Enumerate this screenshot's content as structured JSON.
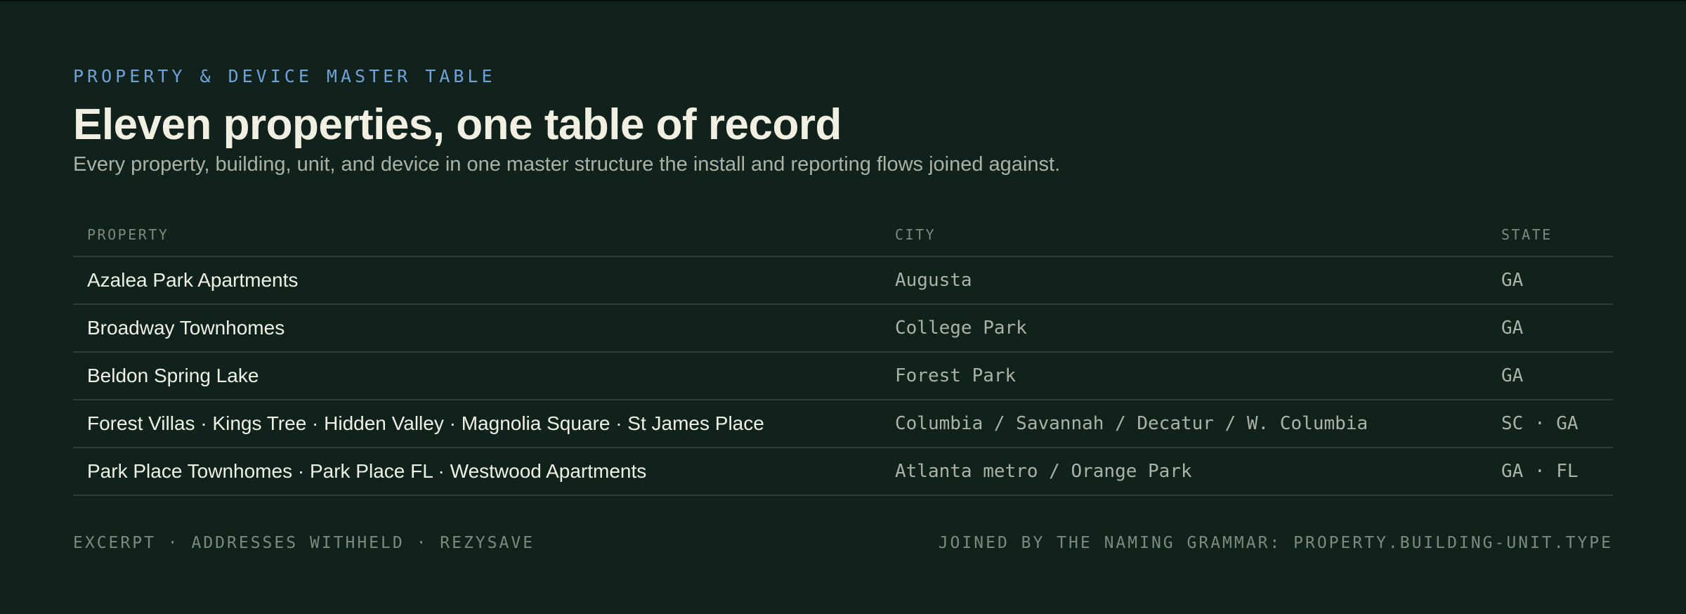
{
  "header": {
    "eyebrow": "PROPERTY & DEVICE MASTER TABLE",
    "title": "Eleven properties, one table of record",
    "subtitle": "Every property, building, unit, and device in one master structure the install and reporting flows joined against."
  },
  "table": {
    "columns": [
      "PROPERTY",
      "CITY",
      "STATE"
    ],
    "rows": [
      {
        "property": "Azalea Park Apartments",
        "city": "Augusta",
        "state": "GA"
      },
      {
        "property": "Broadway Townhomes",
        "city": "College Park",
        "state": "GA"
      },
      {
        "property": "Beldon Spring Lake",
        "city": "Forest Park",
        "state": "GA"
      },
      {
        "property": "Forest Villas · Kings Tree · Hidden Valley · Magnolia Square · St James Place",
        "city": "Columbia / Savannah / Decatur / W. Columbia",
        "state": "SC · GA"
      },
      {
        "property": "Park Place Townhomes · Park Place FL · Westwood Apartments",
        "city": "Atlanta metro / Orange Park",
        "state": "GA · FL"
      }
    ]
  },
  "footer": {
    "left": "EXCERPT · ADDRESSES WITHHELD · REZYSAVE",
    "right": "JOINED BY THE NAMING GRAMMAR: PROPERTY.BUILDING-UNIT.TYPE"
  },
  "colors": {
    "background": "#11221d",
    "accent": "#6fa3d8",
    "title": "#f1efe2",
    "muted": "#7c8a80",
    "rule": "#2d3f38"
  }
}
